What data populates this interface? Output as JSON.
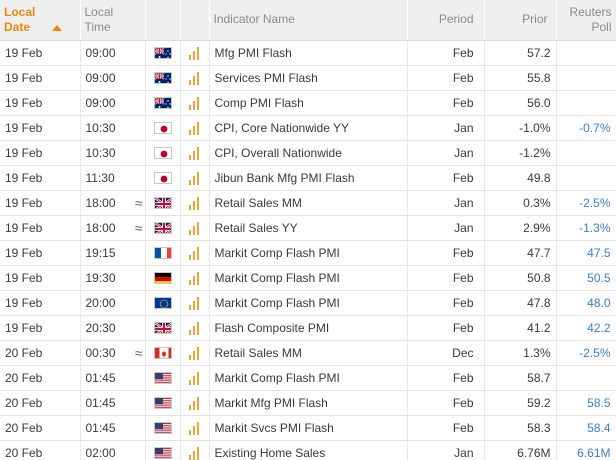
{
  "header": {
    "date": "Local Date",
    "time": "Local Time",
    "indicator": "Indicator Name",
    "period": "Period",
    "prior": "Prior",
    "poll": "Reuters Poll"
  },
  "rows": [
    {
      "date": "19 Feb",
      "time": "09:00",
      "approx": "",
      "flag": "au-flag-icon",
      "indicator": "Mfg PMI Flash",
      "period": "Feb",
      "prior": "57.2",
      "poll": ""
    },
    {
      "date": "19 Feb",
      "time": "09:00",
      "approx": "",
      "flag": "au-flag-icon",
      "indicator": "Services PMI Flash",
      "period": "Feb",
      "prior": "55.8",
      "poll": ""
    },
    {
      "date": "19 Feb",
      "time": "09:00",
      "approx": "",
      "flag": "au-flag-icon",
      "indicator": "Comp PMI Flash",
      "period": "Feb",
      "prior": "56.0",
      "poll": ""
    },
    {
      "date": "19 Feb",
      "time": "10:30",
      "approx": "",
      "flag": "jp-flag-icon",
      "indicator": "CPI, Core Nationwide YY",
      "period": "Jan",
      "prior": "-1.0%",
      "poll": "-0.7%"
    },
    {
      "date": "19 Feb",
      "time": "10:30",
      "approx": "",
      "flag": "jp-flag-icon",
      "indicator": "CPI, Overall Nationwide",
      "period": "Jan",
      "prior": "-1.2%",
      "poll": ""
    },
    {
      "date": "19 Feb",
      "time": "11:30",
      "approx": "",
      "flag": "jp-flag-icon",
      "indicator": "Jibun Bank Mfg PMI Flash",
      "period": "Feb",
      "prior": "49.8",
      "poll": ""
    },
    {
      "date": "19 Feb",
      "time": "18:00",
      "approx": "≈",
      "flag": "gb-flag-icon",
      "indicator": "Retail Sales MM",
      "period": "Jan",
      "prior": "0.3%",
      "poll": "-2.5%"
    },
    {
      "date": "19 Feb",
      "time": "18:00",
      "approx": "≈",
      "flag": "gb-flag-icon",
      "indicator": "Retail Sales YY",
      "period": "Jan",
      "prior": "2.9%",
      "poll": "-1.3%"
    },
    {
      "date": "19 Feb",
      "time": "19:15",
      "approx": "",
      "flag": "fr-flag-icon",
      "indicator": "Markit Comp Flash PMI",
      "period": "Feb",
      "prior": "47.7",
      "poll": "47.5"
    },
    {
      "date": "19 Feb",
      "time": "19:30",
      "approx": "",
      "flag": "de-flag-icon",
      "indicator": "Markit Comp Flash PMI",
      "period": "Feb",
      "prior": "50.8",
      "poll": "50.5"
    },
    {
      "date": "19 Feb",
      "time": "20:00",
      "approx": "",
      "flag": "eu-flag-icon",
      "indicator": "Markit Comp Flash PMI",
      "period": "Feb",
      "prior": "47.8",
      "poll": "48.0"
    },
    {
      "date": "19 Feb",
      "time": "20:30",
      "approx": "",
      "flag": "gb-flag-icon",
      "indicator": "Flash Composite PMI",
      "period": "Feb",
      "prior": "41.2",
      "poll": "42.2"
    },
    {
      "date": "20 Feb",
      "time": "00:30",
      "approx": "≈",
      "flag": "ca-flag-icon",
      "indicator": "Retail Sales MM",
      "period": "Dec",
      "prior": "1.3%",
      "poll": "-2.5%"
    },
    {
      "date": "20 Feb",
      "time": "01:45",
      "approx": "",
      "flag": "us-flag-icon",
      "indicator": "Markit Comp Flash PMI",
      "period": "Feb",
      "prior": "58.7",
      "poll": ""
    },
    {
      "date": "20 Feb",
      "time": "01:45",
      "approx": "",
      "flag": "us-flag-icon",
      "indicator": "Markit Mfg PMI Flash",
      "period": "Feb",
      "prior": "59.2",
      "poll": "58.5"
    },
    {
      "date": "20 Feb",
      "time": "01:45",
      "approx": "",
      "flag": "us-flag-icon",
      "indicator": "Markit Svcs PMI Flash",
      "period": "Feb",
      "prior": "58.3",
      "poll": "58.4"
    },
    {
      "date": "20 Feb",
      "time": "02:00",
      "approx": "",
      "flag": "us-flag-icon",
      "indicator": "Existing Home Sales",
      "period": "Jan",
      "prior": "6.76M",
      "poll": "6.61M"
    }
  ],
  "colors": {
    "accent_sort": "#e8870e",
    "poll_text": "#3a7fd0",
    "importance_bars": "#f0a43a",
    "header_bg": "#efefef"
  },
  "icons": {
    "sort": "sort-ascending-icon",
    "importance": "importance-bars-icon",
    "approx": "approximate-icon"
  }
}
